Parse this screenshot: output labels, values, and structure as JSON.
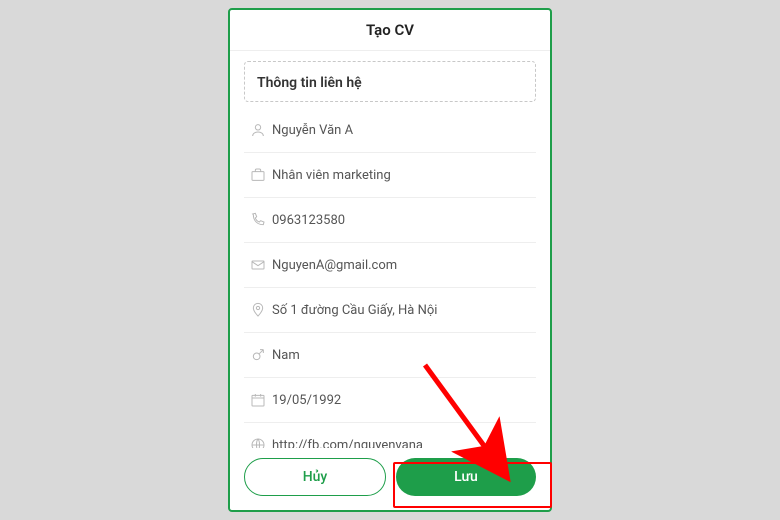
{
  "header": {
    "title": "Tạo CV"
  },
  "section": {
    "title": "Thông tin liên hệ"
  },
  "fields": {
    "name": "Nguyễn Văn A",
    "job": "Nhân viên marketing",
    "phone": "0963123580",
    "email": "NguyenA@gmail.com",
    "address": "Số 1 đường Cầu Giấy, Hà Nội",
    "gender": "Nam",
    "dob": "19/05/1992",
    "website": "http://fb.com/nguyenvana"
  },
  "buttons": {
    "cancel": "Hủy",
    "save": "Lưu"
  }
}
